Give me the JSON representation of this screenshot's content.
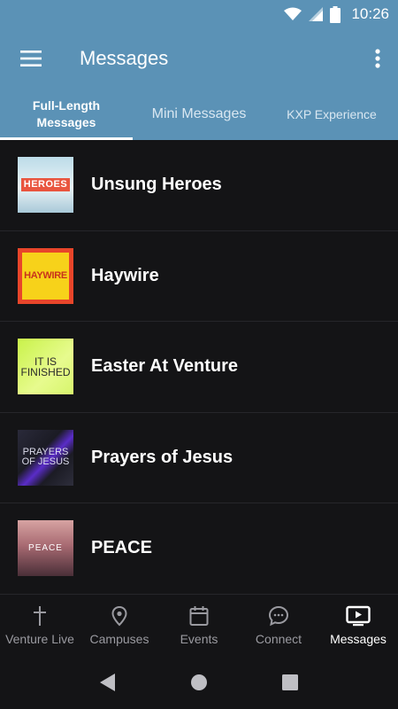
{
  "status_bar": {
    "time": "10:26"
  },
  "app_bar": {
    "title": "Messages"
  },
  "tabs": [
    {
      "label": "Full-Length Messages",
      "active": true
    },
    {
      "label": "Mini Messages",
      "active": false
    },
    {
      "label": "KXP Experience",
      "active": false
    }
  ],
  "messages": [
    {
      "title": "Unsung Heroes",
      "art_text": "HEROES"
    },
    {
      "title": "Haywire",
      "art_text": "HAYWIRE"
    },
    {
      "title": "Easter At Venture",
      "art_text": "IT IS FINISHED"
    },
    {
      "title": "Prayers of Jesus",
      "art_text": "PRAYERS OF JESUS"
    },
    {
      "title": "PEACE",
      "art_text": "PEACE"
    }
  ],
  "bottom_nav": [
    {
      "label": "Venture Live",
      "icon": "cross-icon",
      "active": false
    },
    {
      "label": "Campuses",
      "icon": "location-pin-icon",
      "active": false
    },
    {
      "label": "Events",
      "icon": "calendar-icon",
      "active": false
    },
    {
      "label": "Connect",
      "icon": "chat-bubble-icon",
      "active": false
    },
    {
      "label": "Messages",
      "icon": "tv-play-icon",
      "active": true
    }
  ],
  "colors": {
    "accent": "#5b92b6",
    "background": "#141416",
    "inactive": "#9a9aa0"
  }
}
